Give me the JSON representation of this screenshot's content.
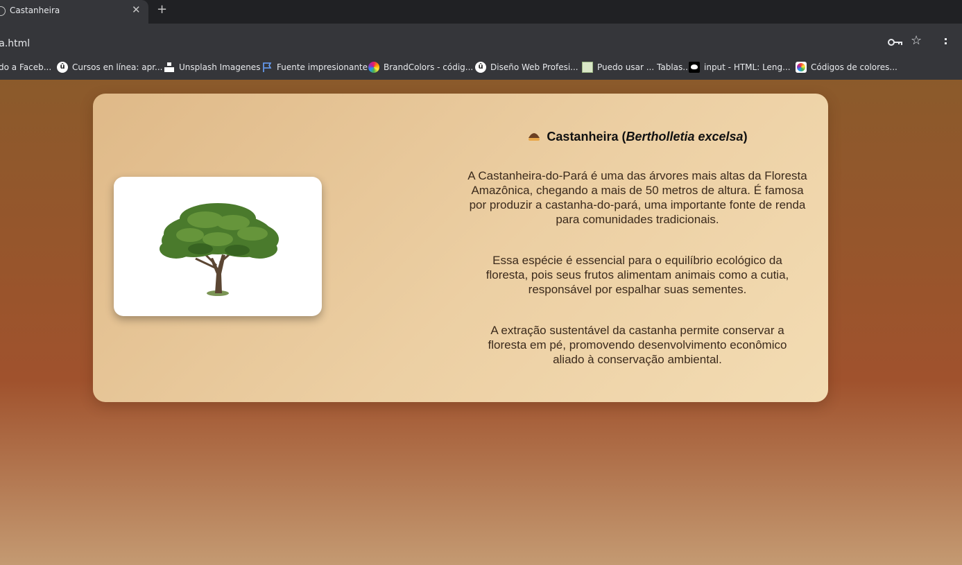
{
  "browser": {
    "tab_title": "Castanheira",
    "tab_close": "✕",
    "new_tab": "+",
    "url": "eira.html",
    "bookmarks": [
      {
        "label": "do a Faceb...",
        "icon": "none"
      },
      {
        "label": "Cursos en línea: apr...",
        "icon": "udemy-icon"
      },
      {
        "label": "Unsplash Imagenes",
        "icon": "unsplash-icon"
      },
      {
        "label": "Fuente impresionante",
        "icon": "flag-icon"
      },
      {
        "label": "BrandColors - códig...",
        "icon": "brandcolors-icon"
      },
      {
        "label": "Diseño Web Profesi...",
        "icon": "udemy-icon"
      },
      {
        "label": "Puedo usar ... Tablas...",
        "icon": "caniuse-icon"
      },
      {
        "label": "input - HTML: Leng...",
        "icon": "mdn-icon"
      },
      {
        "label": "Códigos de colores...",
        "icon": "color-wheel-icon"
      }
    ],
    "udemy_glyph": "û"
  },
  "content": {
    "title_name": "Castanheira (",
    "title_scientific": "Bertholletia excelsa",
    "title_close": ")",
    "paragraphs": [
      "A Castanheira-do-Pará é uma das árvores mais altas da Floresta Amazônica, chegando a mais de 50 metros de altura. É famosa por produzir a castanha-do-pará, uma importante fonte de renda para comunidades tradicionais.",
      "Essa espécie é essencial para o equilíbrio ecológico da floresta, pois seus frutos alimentam animais como a cutia, responsável por espalhar suas sementes.",
      "A extração sustentável da castanha permite conservar a floresta em pé, promovendo desenvolvimento econômico aliado à conservação ambiental."
    ],
    "image": "tree-image"
  },
  "colors": {
    "background_top": "#8b5a2b",
    "background_mid": "#a0522d",
    "card": "#eccfa3",
    "text": "#3b2a1c"
  }
}
